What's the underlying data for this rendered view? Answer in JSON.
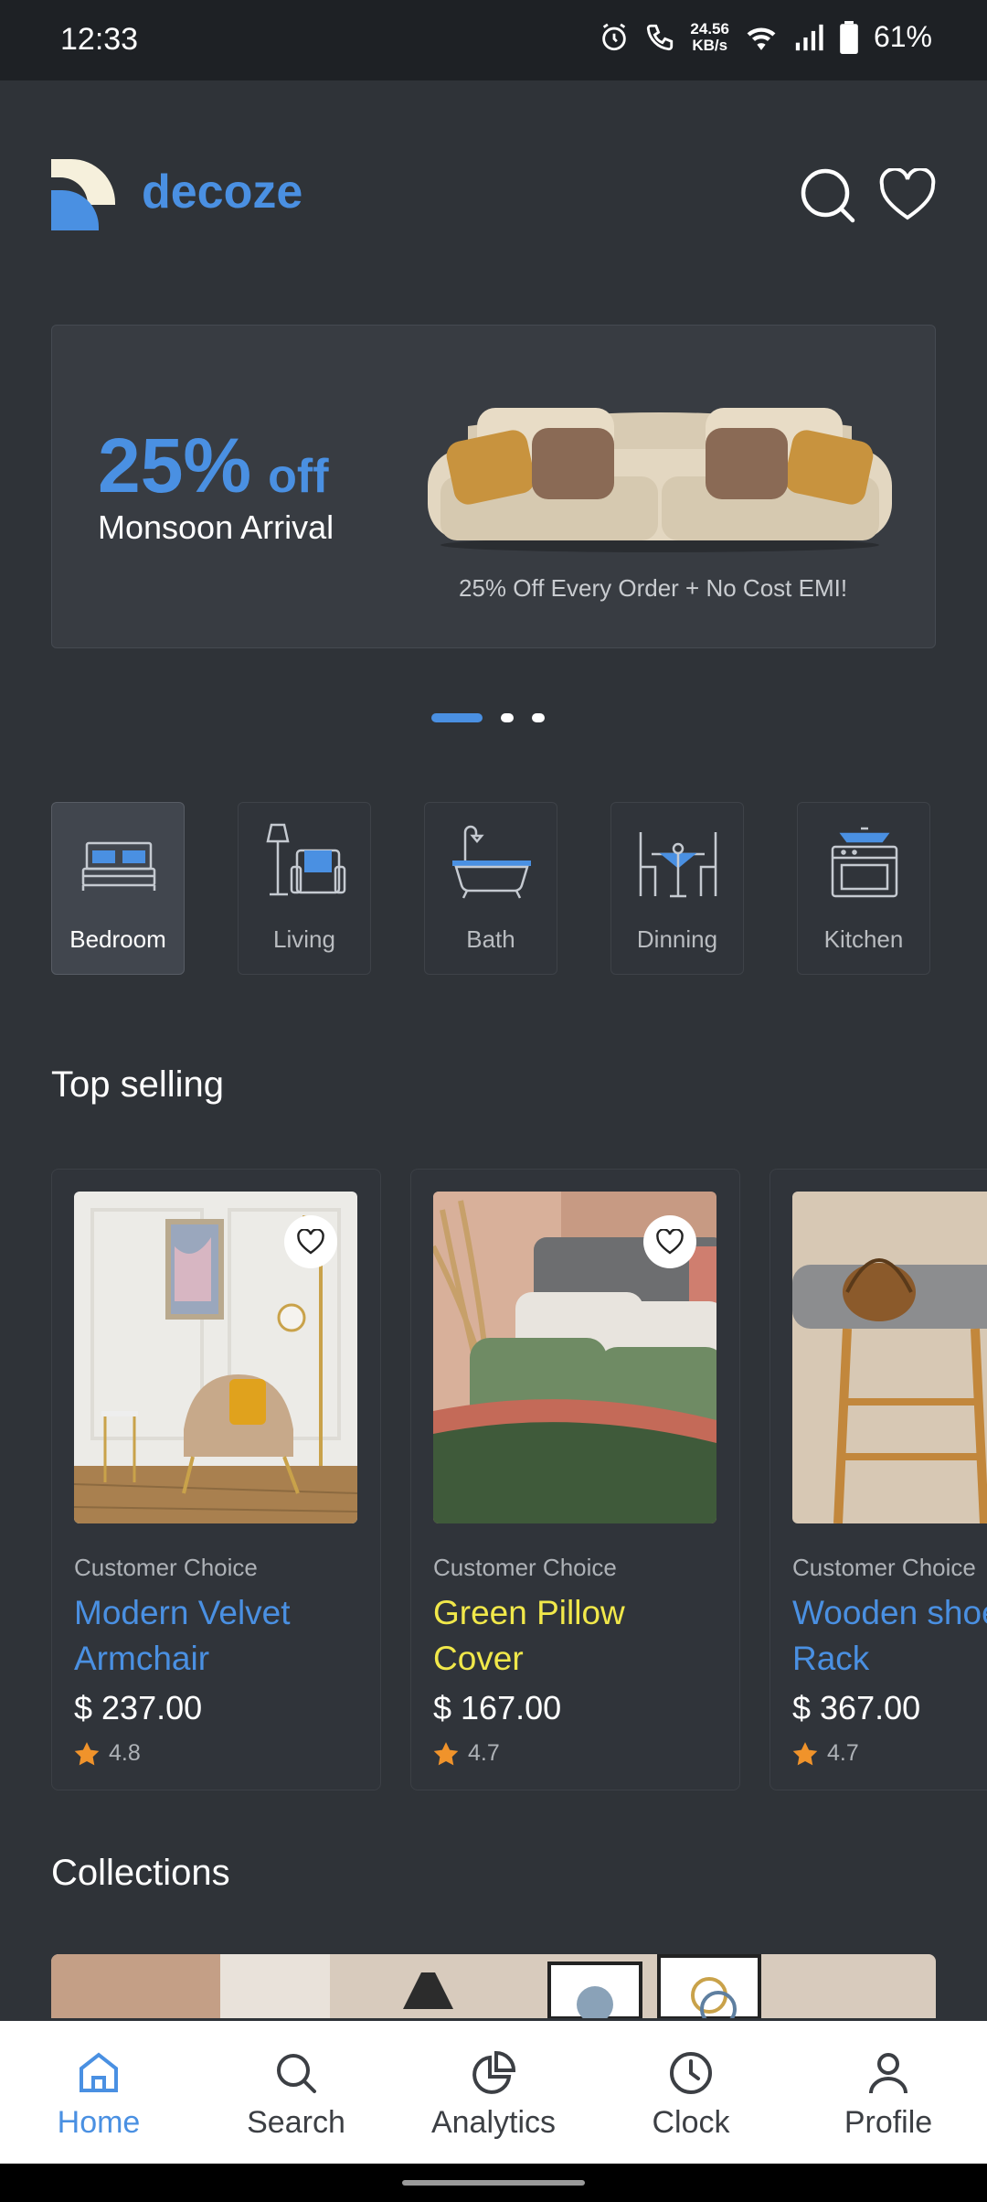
{
  "status_bar": {
    "time": "12:33",
    "speed": "24.56",
    "speed_unit": "KB/s",
    "battery": "61%"
  },
  "header": {
    "brand": "decoze"
  },
  "banner": {
    "discount": "25%",
    "off": "off",
    "subtitle": "Monsoon Arrival",
    "terms": "25% Off Every Order + No Cost EMI!",
    "slide_count": 3,
    "active_slide": 1
  },
  "categories": [
    {
      "label": "Bedroom",
      "icon": "bed-icon",
      "active": true
    },
    {
      "label": "Living",
      "icon": "armchair-lamp-icon",
      "active": false
    },
    {
      "label": "Bath",
      "icon": "bathtub-icon",
      "active": false
    },
    {
      "label": "Dinning",
      "icon": "dining-table-icon",
      "active": false
    },
    {
      "label": "Kitchen",
      "icon": "oven-icon",
      "active": false
    }
  ],
  "sections": {
    "top_selling": "Top selling",
    "collections": "Collections"
  },
  "products": [
    {
      "tag": "Customer Choice",
      "name": "Modern Velvet Armchair",
      "price": "$ 237.00",
      "rating": "4.8"
    },
    {
      "tag": "Customer Choice",
      "name": "Green Pillow Cover",
      "price": "$ 167.00",
      "rating": "4.7"
    },
    {
      "tag": "Customer Choice",
      "name": "Wooden shoe Rack",
      "price": "$ 367.00",
      "rating": "4.7"
    }
  ],
  "nav": [
    {
      "label": "Home",
      "icon": "home-icon",
      "active": true
    },
    {
      "label": "Search",
      "icon": "search-icon",
      "active": false
    },
    {
      "label": "Analytics",
      "icon": "pie-chart-icon",
      "active": false
    },
    {
      "label": "Clock",
      "icon": "clock-icon",
      "active": false
    },
    {
      "label": "Profile",
      "icon": "user-icon",
      "active": false
    }
  ],
  "colors": {
    "accent": "#4a90e2",
    "background": "#2f3338",
    "highlight_name": "#f1e84a",
    "star": "#f0932b"
  }
}
